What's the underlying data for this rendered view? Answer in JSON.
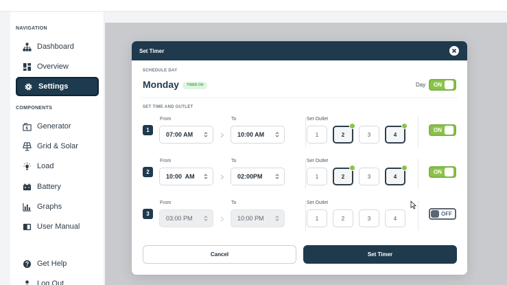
{
  "sidebar": {
    "nav_heading": "NAVIGATION",
    "components_heading": "COMPONENTS",
    "items": [
      {
        "label": "Dashboard",
        "icon": "sitemap-icon"
      },
      {
        "label": "Overview",
        "icon": "grid-icon"
      },
      {
        "label": "Settings",
        "icon": "gear-icon",
        "active": true
      },
      {
        "label": "Generator",
        "icon": "generator-icon"
      },
      {
        "label": "Grid & Solar",
        "icon": "solar-panel-icon"
      },
      {
        "label": "Load",
        "icon": "lightbulb-icon"
      },
      {
        "label": "Battery",
        "icon": "battery-icon"
      },
      {
        "label": "Graphs",
        "icon": "bar-chart-icon"
      },
      {
        "label": "User Manual",
        "icon": "book-icon"
      },
      {
        "label": "Get Help",
        "icon": "help-circle-icon"
      },
      {
        "label": "Log Out",
        "icon": "logout-icon"
      }
    ]
  },
  "modal": {
    "title": "Set Timer",
    "schedule_day_label": "SCHEDULE DAY",
    "day": "Monday",
    "timer_badge": "TIMER ON",
    "day_toggle_label": "Day",
    "day_toggle_state": "ON",
    "set_time_label": "SET TIME AND OUTLET",
    "from_label": "From",
    "to_label": "To",
    "outlet_label": "Set Outlet",
    "outlets": [
      "1",
      "2",
      "3",
      "4"
    ],
    "rows": [
      {
        "num": "1",
        "from": "07:00 AM",
        "to": "10:00 AM",
        "selected_outlets": [
          "2",
          "4"
        ],
        "state": "ON",
        "enabled": true
      },
      {
        "num": "2",
        "from": "10:00  AM",
        "to": "02:00PM",
        "selected_outlets": [
          "2",
          "4"
        ],
        "state": "ON",
        "enabled": true
      },
      {
        "num": "3",
        "from": "03:00 PM",
        "to": "10:00 PM",
        "selected_outlets": [],
        "state": "OFF",
        "enabled": false
      }
    ],
    "cancel_label": "Cancel",
    "submit_label": "Set Timer"
  },
  "colors": {
    "primary": "#1f3a4d",
    "accent_green": "#8bc34a",
    "overlay": "#c8cacd"
  }
}
